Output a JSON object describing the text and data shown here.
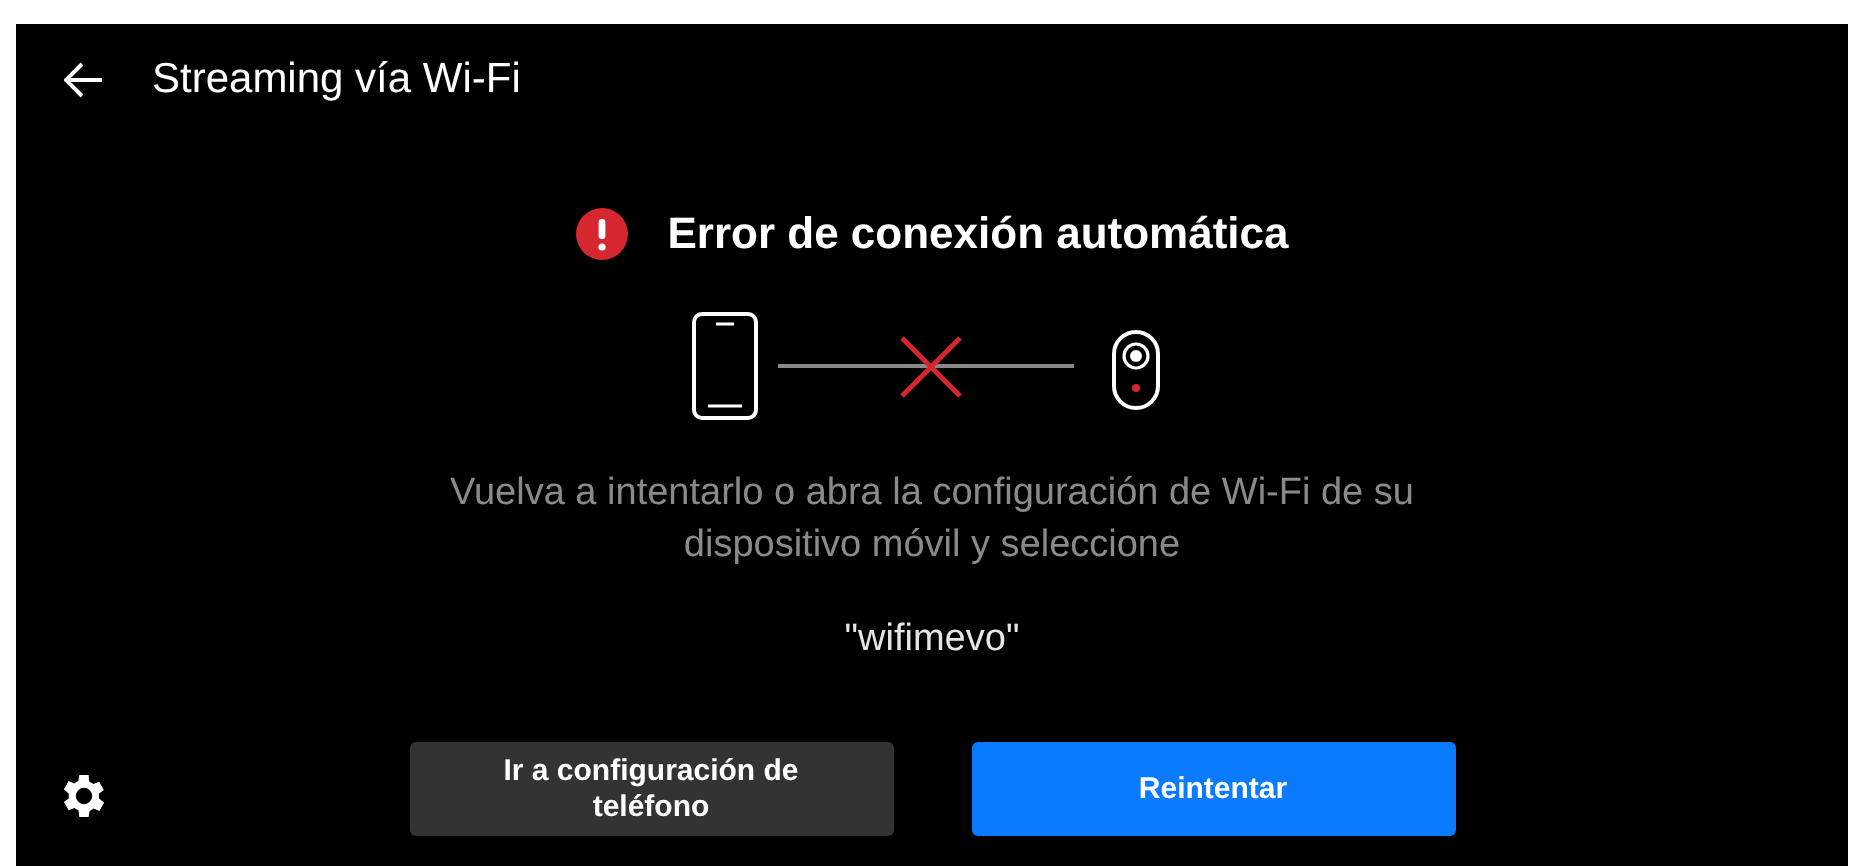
{
  "header": {
    "title": "Streaming vía Wi-Fi"
  },
  "error": {
    "title": "Error de conexión automática",
    "message": "Vuelva a intentarlo o abra la configuración de Wi-Fi de su dispositivo móvil y seleccione",
    "network": "\"wifimevo\""
  },
  "buttons": [
    {
      "label": "Ir a configuración de teléfono",
      "kind": "secondary"
    },
    {
      "label": "Reintentar",
      "kind": "primary"
    }
  ]
}
